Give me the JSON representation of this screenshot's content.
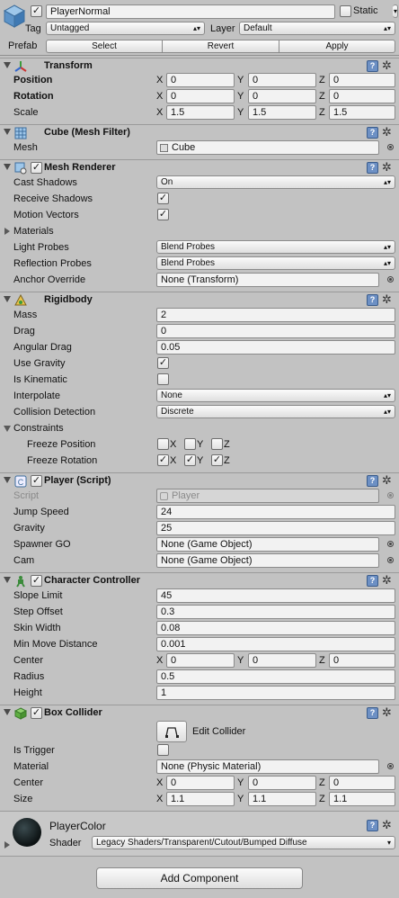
{
  "header": {
    "object_name": "PlayerNormal",
    "static_label": "Static",
    "tag_label": "Tag",
    "tag_value": "Untagged",
    "layer_label": "Layer",
    "layer_value": "Default",
    "prefab_label": "Prefab",
    "prefab_buttons": [
      "Select",
      "Revert",
      "Apply"
    ]
  },
  "transform": {
    "title": "Transform",
    "rows": [
      {
        "label": "Position",
        "x": "0",
        "y": "0",
        "z": "0"
      },
      {
        "label": "Rotation",
        "x": "0",
        "y": "0",
        "z": "0"
      },
      {
        "label": "Scale",
        "x": "1.5",
        "y": "1.5",
        "z": "1.5"
      }
    ]
  },
  "axes": {
    "x": "X",
    "y": "Y",
    "z": "Z"
  },
  "mesh_filter": {
    "title": "Cube (Mesh Filter)",
    "mesh_label": "Mesh",
    "mesh_value": "Cube"
  },
  "mesh_renderer": {
    "title": "Mesh Renderer",
    "cast_shadows_label": "Cast Shadows",
    "cast_shadows_value": "On",
    "receive_shadows_label": "Receive Shadows",
    "motion_vectors_label": "Motion Vectors",
    "materials_label": "Materials",
    "light_probes_label": "Light Probes",
    "light_probes_value": "Blend Probes",
    "reflection_probes_label": "Reflection Probes",
    "reflection_probes_value": "Blend Probes",
    "anchor_override_label": "Anchor Override",
    "anchor_override_value": "None (Transform)"
  },
  "rigidbody": {
    "title": "Rigidbody",
    "mass_label": "Mass",
    "mass": "2",
    "drag_label": "Drag",
    "drag": "0",
    "angular_drag_label": "Angular Drag",
    "angular_drag": "0.05",
    "use_gravity_label": "Use Gravity",
    "is_kinematic_label": "Is Kinematic",
    "interpolate_label": "Interpolate",
    "interpolate": "None",
    "collision_label": "Collision Detection",
    "collision": "Discrete",
    "constraints_label": "Constraints",
    "freeze_position_label": "Freeze Position",
    "freeze_rotation_label": "Freeze Rotation"
  },
  "player_script": {
    "title": "Player (Script)",
    "script_label": "Script",
    "script_value": "Player",
    "jump_speed_label": "Jump Speed",
    "jump_speed": "24",
    "gravity_label": "Gravity",
    "gravity": "25",
    "spawner_label": "Spawner GO",
    "spawner": "None (Game Object)",
    "cam_label": "Cam",
    "cam": "None (Game Object)"
  },
  "character_controller": {
    "title": "Character Controller",
    "slope_label": "Slope Limit",
    "slope": "45",
    "step_label": "Step Offset",
    "step": "0.3",
    "skin_label": "Skin Width",
    "skin": "0.08",
    "min_move_label": "Min Move Distance",
    "min_move": "0.001",
    "center_label": "Center",
    "cx": "0",
    "cy": "0",
    "cz": "0",
    "radius_label": "Radius",
    "radius": "0.5",
    "height_label": "Height",
    "height": "1"
  },
  "box_collider": {
    "title": "Box Collider",
    "edit_label": "Edit Collider",
    "is_trigger_label": "Is Trigger",
    "material_label": "Material",
    "material": "None (Physic Material)",
    "center_label": "Center",
    "cx": "0",
    "cy": "0",
    "cz": "0",
    "size_label": "Size",
    "sx": "1.1",
    "sy": "1.1",
    "sz": "1.1"
  },
  "material": {
    "name": "PlayerColor",
    "shader_label": "Shader",
    "shader_value": "Legacy Shaders/Transparent/Cutout/Bumped Diffuse"
  },
  "add_component_label": "Add Component",
  "colors": {
    "panel": "#c2c2c2",
    "help_icon": "#6d90c4",
    "field": "#f2f2f2"
  }
}
